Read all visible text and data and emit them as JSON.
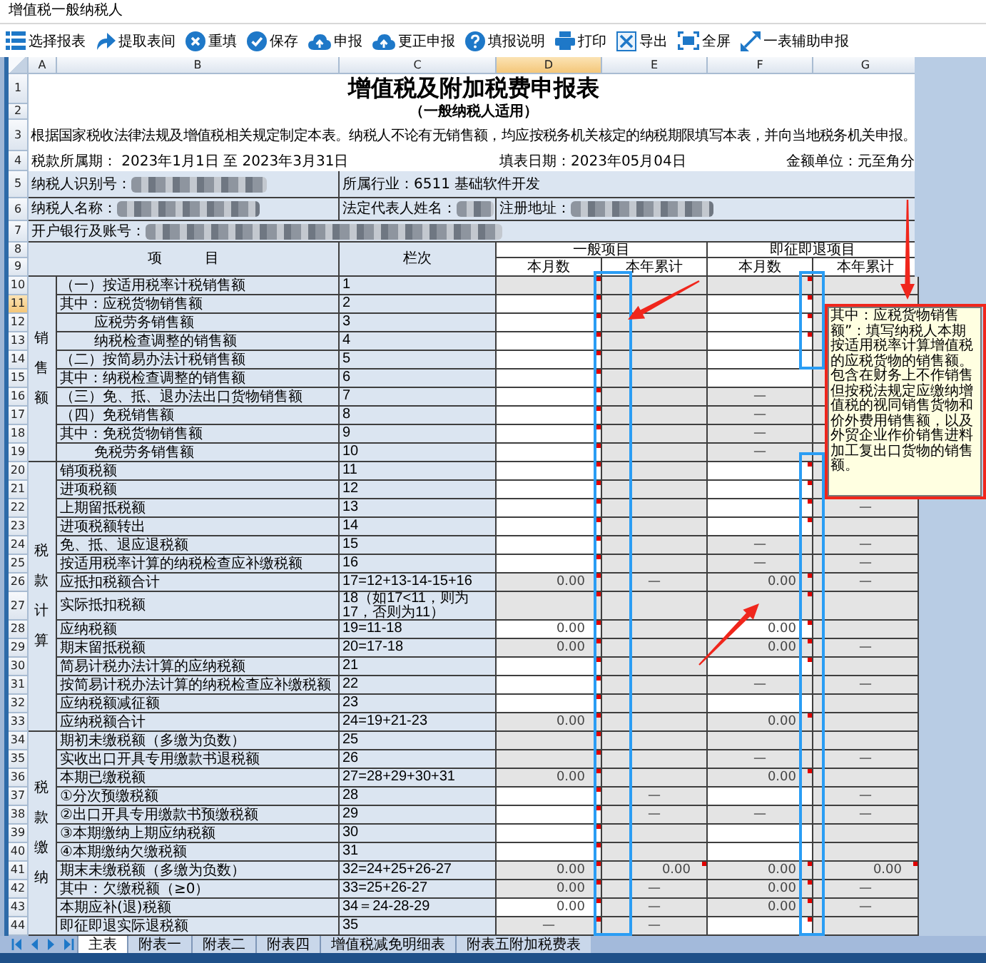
{
  "window": {
    "title": "增值税一般纳税人"
  },
  "toolbar": [
    {
      "label": "选择报表"
    },
    {
      "label": "提取表间"
    },
    {
      "label": "重填"
    },
    {
      "label": "保存"
    },
    {
      "label": "申报"
    },
    {
      "label": "更正申报"
    },
    {
      "label": "填报说明"
    },
    {
      "label": "打印"
    },
    {
      "label": "导出"
    },
    {
      "label": "全屏"
    },
    {
      "label": "一表辅助申报"
    }
  ],
  "sheet": {
    "columns": [
      {
        "label": "A",
        "selected": false
      },
      {
        "label": "B",
        "selected": false
      },
      {
        "label": "C",
        "selected": false
      },
      {
        "label": "D",
        "selected": true
      },
      {
        "label": "E",
        "selected": false
      },
      {
        "label": "F",
        "selected": false
      },
      {
        "label": "G",
        "selected": false
      }
    ],
    "row_numbers": [
      {
        "label": "1",
        "selected": false
      },
      {
        "label": "2",
        "selected": false
      },
      {
        "label": "3",
        "selected": false
      },
      {
        "label": "4",
        "selected": false
      },
      {
        "label": "5",
        "selected": false
      },
      {
        "label": "6",
        "selected": false
      },
      {
        "label": "7",
        "selected": false
      },
      {
        "label": "8",
        "selected": false
      },
      {
        "label": "9",
        "selected": false
      },
      {
        "label": "10",
        "selected": false
      },
      {
        "label": "11",
        "selected": true
      },
      {
        "label": "12",
        "selected": false
      },
      {
        "label": "13",
        "selected": false
      },
      {
        "label": "14",
        "selected": false
      },
      {
        "label": "15",
        "selected": false
      },
      {
        "label": "16",
        "selected": false
      },
      {
        "label": "17",
        "selected": false
      },
      {
        "label": "18",
        "selected": false
      },
      {
        "label": "19",
        "selected": false
      },
      {
        "label": "20",
        "selected": false
      },
      {
        "label": "21",
        "selected": false
      },
      {
        "label": "22",
        "selected": false
      },
      {
        "label": "23",
        "selected": false
      },
      {
        "label": "24",
        "selected": false
      },
      {
        "label": "25",
        "selected": false
      },
      {
        "label": "26",
        "selected": false
      },
      {
        "label": "27",
        "selected": false
      },
      {
        "label": "28",
        "selected": false
      },
      {
        "label": "29",
        "selected": false
      },
      {
        "label": "30",
        "selected": false
      },
      {
        "label": "31",
        "selected": false
      },
      {
        "label": "32",
        "selected": false
      },
      {
        "label": "33",
        "selected": false
      },
      {
        "label": "34",
        "selected": false
      },
      {
        "label": "35",
        "selected": false
      },
      {
        "label": "36",
        "selected": false
      },
      {
        "label": "37",
        "selected": false
      },
      {
        "label": "38",
        "selected": false
      },
      {
        "label": "39",
        "selected": false
      },
      {
        "label": "40",
        "selected": false
      },
      {
        "label": "41",
        "selected": false
      },
      {
        "label": "42",
        "selected": false
      },
      {
        "label": "43",
        "selected": false
      },
      {
        "label": "44",
        "selected": false
      }
    ],
    "title": "增值税及附加税费申报表",
    "subtitle": "（一般纳税人适用）",
    "notice": "根据国家税收法律法规及增值税相关规定制定本表。纳税人不论有无销售额，均应按税务机关核定的纳税期限填写本表，并向当地税务机关申报。",
    "period": "税款所属期：  2023年1月1日 至 2023年3月31日",
    "fill_date": "填表日期：2023年05月04日",
    "unit": "金额单位：元至角分",
    "info_fields": [
      {
        "label": "纳税人识别号：",
        "blurred": true
      },
      {
        "label": "所属行业：6511 基础软件开发",
        "blurred": false
      },
      {
        "label": "纳税人名称：",
        "blurred": true
      },
      {
        "label": "法定代表人姓名：",
        "blurred": true
      },
      {
        "label": "注册地址：",
        "blurred": true
      },
      {
        "label": "开户银行及账号：",
        "blurred": true
      }
    ],
    "headers": {
      "item": "项　　　目",
      "line_no": "栏次",
      "general": "一般项目",
      "immediate": "即征即退项目",
      "sub": [
        "本月数",
        "本年累计",
        "本月数",
        "本年累计"
      ]
    },
    "sections": [
      {
        "label": "销售额",
        "rows": [
          {
            "label": "（一）按适用税率计税销售额",
            "kind": "item",
            "line": "1",
            "cells": [
              {
                "editable": false,
                "note": true
              },
              {
                "editable": false,
                "note": false
              },
              {
                "editable": false,
                "note": true
              },
              {
                "editable": false,
                "note": false
              }
            ]
          },
          {
            "label": "其中：应税货物销售额",
            "kind": "item",
            "line": "2",
            "cells": [
              {
                "editable": true,
                "note": true
              },
              {
                "editable": false,
                "note": false
              },
              {
                "editable": true,
                "note": true
              },
              {
                "editable": false
              }
            ]
          },
          {
            "label": "应税劳务销售额",
            "kind": "sub",
            "line": "3",
            "cells": [
              {
                "editable": true,
                "note": true
              },
              {
                "editable": false,
                "note": false
              },
              {
                "editable": true,
                "note": true
              },
              {
                "editable": false
              }
            ]
          },
          {
            "label": "纳税检查调整的销售额",
            "kind": "sub",
            "line": "4",
            "cells": [
              {
                "editable": true,
                "note": true
              },
              {
                "editable": false,
                "note": false
              },
              {
                "editable": true,
                "note": true
              },
              {
                "editable": false
              }
            ]
          },
          {
            "label": "（二）按简易办法计税销售额",
            "kind": "item",
            "line": "5",
            "cells": [
              {
                "editable": true,
                "note": true
              },
              {
                "editable": false,
                "note": false
              },
              {
                "editable": true,
                "note": false
              },
              {
                "editable": false
              }
            ]
          },
          {
            "label": "其中：纳税检查调整的销售额",
            "kind": "item",
            "line": "6",
            "cells": [
              {
                "editable": true,
                "note": true
              },
              {
                "editable": false,
                "note": false
              },
              {
                "editable": true,
                "note": false
              },
              {
                "editable": false
              }
            ]
          },
          {
            "label": "（三）免、抵、退办法出口货物销售额",
            "kind": "item",
            "line": "7",
            "cells": [
              {
                "editable": true,
                "note": true
              },
              {
                "editable": false,
                "note": false
              },
              {
                "editable": false,
                "note": false,
                "value": "—",
                "kind": "na"
              },
              {
                "editable": false
              }
            ]
          },
          {
            "label": "（四）免税销售额",
            "kind": "item",
            "line": "8",
            "cells": [
              {
                "editable": true,
                "note": true
              },
              {
                "editable": false,
                "note": false
              },
              {
                "editable": false,
                "note": false,
                "value": "—",
                "kind": "na"
              },
              {
                "editable": false
              }
            ]
          },
          {
            "label": "其中：免税货物销售额",
            "kind": "item",
            "line": "9",
            "cells": [
              {
                "editable": true,
                "note": true
              },
              {
                "editable": false,
                "note": false
              },
              {
                "editable": false,
                "note": false,
                "value": "—",
                "kind": "na"
              },
              {
                "editable": false
              }
            ]
          },
          {
            "label": "免税劳务销售额",
            "kind": "sub",
            "line": "10",
            "cells": [
              {
                "editable": true,
                "note": true
              },
              {
                "editable": false,
                "note": false
              },
              {
                "editable": false,
                "note": false,
                "value": "—",
                "kind": "na"
              },
              {
                "editable": false
              }
            ]
          }
        ]
      },
      {
        "label": "税款计算",
        "rows": [
          {
            "label": "销项税额",
            "kind": "item",
            "line": "11",
            "cells": [
              {
                "editable": true,
                "note": true
              },
              {
                "editable": false,
                "note": false
              },
              {
                "editable": true,
                "note": true
              },
              {
                "editable": false
              }
            ]
          },
          {
            "label": "进项税额",
            "kind": "item",
            "line": "12",
            "cells": [
              {
                "editable": true,
                "note": true
              },
              {
                "editable": false,
                "note": false
              },
              {
                "editable": true,
                "note": true
              },
              {
                "editable": false
              }
            ]
          },
          {
            "label": "上期留抵税额",
            "kind": "item",
            "line": "13",
            "cells": [
              {
                "editable": true,
                "note": true
              },
              {
                "editable": false,
                "note": false
              },
              {
                "editable": true,
                "note": true
              },
              {
                "editable": false,
                "note": false,
                "value": "—",
                "kind": "na"
              }
            ]
          },
          {
            "label": "进项税额转出",
            "kind": "item",
            "line": "14",
            "cells": [
              {
                "editable": true,
                "note": true
              },
              {
                "editable": false,
                "note": false
              },
              {
                "editable": true,
                "note": true
              },
              {
                "editable": false,
                "note": false
              }
            ]
          },
          {
            "label": "免、抵、退应退税额",
            "kind": "item",
            "line": "15",
            "cells": [
              {
                "editable": true,
                "note": true
              },
              {
                "editable": false,
                "note": false
              },
              {
                "editable": false,
                "note": false,
                "value": "—",
                "kind": "na"
              },
              {
                "editable": false,
                "note": false,
                "value": "—",
                "kind": "na"
              }
            ]
          },
          {
            "label": "按适用税率计算的纳税检查应补缴税额",
            "kind": "item",
            "line": "16",
            "cells": [
              {
                "editable": true,
                "note": true
              },
              {
                "editable": false,
                "note": false
              },
              {
                "editable": false,
                "note": false,
                "value": "—",
                "kind": "na"
              },
              {
                "editable": false,
                "note": false,
                "value": "—",
                "kind": "na"
              }
            ]
          },
          {
            "label": "应抵扣税额合计",
            "kind": "item",
            "line": "17=12+13-14-15+16",
            "cells": [
              {
                "editable": false,
                "note": true,
                "value": "0.00",
                "kind": "amount"
              },
              {
                "editable": false,
                "note": false,
                "value": "—",
                "kind": "na"
              },
              {
                "editable": false,
                "note": true,
                "value": "0.00",
                "kind": "amount"
              },
              {
                "editable": false,
                "note": false,
                "value": "—",
                "kind": "na"
              }
            ]
          },
          {
            "label": "实际抵扣税额",
            "kind": "item",
            "line": "18（如17<11，则为17，否则为11）",
            "cells": [
              {
                "editable": false,
                "note": true
              },
              {
                "editable": false,
                "note": false
              },
              {
                "editable": false,
                "note": true
              },
              {
                "editable": false,
                "note": false
              }
            ]
          },
          {
            "label": "应纳税额",
            "kind": "item",
            "line": "19=11-18",
            "cells": [
              {
                "editable": true,
                "note": true,
                "value": "0.00",
                "kind": "amount"
              },
              {
                "editable": false,
                "note": false
              },
              {
                "editable": true,
                "note": true,
                "value": "0.00",
                "kind": "amount"
              },
              {
                "editable": false,
                "note": false
              }
            ]
          },
          {
            "label": "期末留抵税额",
            "kind": "item",
            "line": "20=17-18",
            "cells": [
              {
                "editable": false,
                "note": true,
                "value": "0.00",
                "kind": "amount"
              },
              {
                "editable": false,
                "note": false
              },
              {
                "editable": false,
                "note": true,
                "value": "0.00",
                "kind": "amount"
              },
              {
                "editable": false,
                "note": false,
                "value": "—",
                "kind": "na"
              }
            ]
          },
          {
            "label": "简易计税办法计算的应纳税额",
            "kind": "item",
            "line": "21",
            "cells": [
              {
                "editable": true,
                "note": true
              },
              {
                "editable": false,
                "note": false
              },
              {
                "editable": true,
                "note": true
              },
              {
                "editable": false,
                "note": false
              }
            ]
          },
          {
            "label": "按简易计税办法计算的纳税检查应补缴税额",
            "kind": "item",
            "line": "22",
            "cells": [
              {
                "editable": true,
                "note": true
              },
              {
                "editable": false,
                "note": false
              },
              {
                "editable": false,
                "note": false,
                "value": "—",
                "kind": "na"
              },
              {
                "editable": false,
                "note": false,
                "value": "—",
                "kind": "na"
              }
            ]
          },
          {
            "label": "应纳税额减征额",
            "kind": "item",
            "line": "23",
            "cells": [
              {
                "editable": true,
                "note": true
              },
              {
                "editable": false,
                "note": false
              },
              {
                "editable": true,
                "note": false
              },
              {
                "editable": false,
                "note": false
              }
            ]
          },
          {
            "label": "应纳税额合计",
            "kind": "item",
            "line": "24=19+21-23",
            "cells": [
              {
                "editable": false,
                "note": true,
                "value": "0.00",
                "kind": "amount"
              },
              {
                "editable": false,
                "note": false
              },
              {
                "editable": false,
                "note": true,
                "value": "0.00",
                "kind": "amount"
              },
              {
                "editable": false,
                "note": false
              }
            ]
          }
        ]
      },
      {
        "label": "税款缴纳",
        "rows": [
          {
            "label": "期初未缴税额（多缴为负数）",
            "kind": "item",
            "line": "25",
            "cells": [
              {
                "editable": false,
                "note": true
              },
              {
                "editable": false,
                "note": false
              },
              {
                "editable": false,
                "note": false
              },
              {
                "editable": false,
                "note": false
              }
            ]
          },
          {
            "label": "实收出口开具专用缴款书退税额",
            "kind": "item",
            "line": "26",
            "cells": [
              {
                "editable": false,
                "note": true
              },
              {
                "editable": false,
                "note": false
              },
              {
                "editable": false,
                "note": false,
                "value": "—",
                "kind": "na"
              },
              {
                "editable": false,
                "note": false,
                "value": "—",
                "kind": "na"
              }
            ]
          },
          {
            "label": "本期已缴税额",
            "kind": "item",
            "line": "27=28+29+30+31",
            "cells": [
              {
                "editable": false,
                "note": true,
                "value": "0.00",
                "kind": "amount"
              },
              {
                "editable": false,
                "note": false
              },
              {
                "editable": false,
                "note": true,
                "value": "0.00",
                "kind": "amount"
              },
              {
                "editable": false,
                "note": false
              }
            ]
          },
          {
            "label": "①分次预缴税额",
            "kind": "item",
            "line": "28",
            "cells": [
              {
                "editable": true,
                "note": true
              },
              {
                "editable": false,
                "note": false,
                "value": "—",
                "kind": "na"
              },
              {
                "editable": true,
                "note": false
              },
              {
                "editable": false,
                "note": false,
                "value": "—",
                "kind": "na"
              }
            ]
          },
          {
            "label": "②出口开具专用缴款书预缴税额",
            "kind": "item",
            "line": "29",
            "cells": [
              {
                "editable": true,
                "note": true
              },
              {
                "editable": false,
                "note": false,
                "value": "—",
                "kind": "na"
              },
              {
                "editable": false,
                "note": false,
                "value": "—",
                "kind": "na"
              },
              {
                "editable": false,
                "note": false,
                "value": "—",
                "kind": "na"
              }
            ]
          },
          {
            "label": "③本期缴纳上期应纳税额",
            "kind": "item",
            "line": "30",
            "cells": [
              {
                "editable": true,
                "note": true
              },
              {
                "editable": false,
                "note": false
              },
              {
                "editable": true,
                "note": false
              },
              {
                "editable": false,
                "note": false
              }
            ]
          },
          {
            "label": "④本期缴纳欠缴税额",
            "kind": "item",
            "line": "31",
            "cells": [
              {
                "editable": true,
                "note": true
              },
              {
                "editable": false,
                "note": false
              },
              {
                "editable": true,
                "note": false
              },
              {
                "editable": false,
                "note": false
              }
            ]
          },
          {
            "label": "期末未缴税额（多缴为负数）",
            "kind": "item",
            "line": "32=24+25+26-27",
            "cells": [
              {
                "editable": false,
                "note": true,
                "value": "0.00",
                "kind": "amount"
              },
              {
                "editable": false,
                "note": true,
                "value": "0.00",
                "kind": "amount"
              },
              {
                "editable": false,
                "note": true,
                "value": "0.00",
                "kind": "amount"
              },
              {
                "editable": false,
                "note": true,
                "value": "0.00",
                "kind": "amount"
              }
            ]
          },
          {
            "label": "其中：欠缴税额（≥0）",
            "kind": "item",
            "line": "33=25+26-27",
            "cells": [
              {
                "editable": false,
                "note": true,
                "value": "0.00",
                "kind": "amount"
              },
              {
                "editable": false,
                "note": false,
                "value": "—",
                "kind": "na"
              },
              {
                "editable": false,
                "note": true,
                "value": "0.00",
                "kind": "amount"
              },
              {
                "editable": false,
                "note": false,
                "value": "—",
                "kind": "na"
              }
            ]
          },
          {
            "label": "本期应补(退)税额",
            "kind": "item",
            "line": "34＝24-28-29",
            "cells": [
              {
                "editable": true,
                "note": true,
                "value": "0.00",
                "kind": "amount"
              },
              {
                "editable": false,
                "note": false,
                "value": "—",
                "kind": "na"
              },
              {
                "editable": false,
                "note": true,
                "value": "0.00",
                "kind": "amount"
              },
              {
                "editable": false,
                "note": false,
                "value": "—",
                "kind": "na"
              }
            ]
          },
          {
            "label": "即征即退实际退税额",
            "kind": "item",
            "line": "35",
            "cells": [
              {
                "editable": false,
                "note": true,
                "value": "—",
                "kind": "na"
              },
              {
                "editable": false,
                "note": false,
                "value": "—",
                "kind": "na"
              },
              {
                "editable": true,
                "note": true
              },
              {
                "editable": false,
                "note": false
              }
            ]
          }
        ]
      }
    ]
  },
  "tooltip": {
    "text": "其中：应税货物销售额”：填写纳税人本期按适用税率计算增值税的应税货物的销售额。包含在财务上不作销售但按税法规定应缴纳增值税的视同销售货物和价外费用销售额，以及外贸企业作价销售进料加工复出口货物的销售额。"
  },
  "annotations": [
    {
      "kind": "frame",
      "color": "#2a9df4"
    },
    {
      "kind": "frame",
      "color": "#2a9df4"
    },
    {
      "kind": "frame",
      "color": "#2a9df4"
    },
    {
      "kind": "frame",
      "color": "#f0261c"
    },
    {
      "kind": "arrow",
      "color": "#f0261c"
    },
    {
      "kind": "arrow",
      "color": "#f0261c"
    },
    {
      "kind": "arrow",
      "color": "#f0261c"
    }
  ],
  "sheet_tabs": [
    {
      "label": "主表",
      "selected": true
    },
    {
      "label": "附表一",
      "selected": false
    },
    {
      "label": "附表二",
      "selected": false
    },
    {
      "label": "附表四",
      "selected": false
    },
    {
      "label": "增值税减免明细表",
      "selected": false
    },
    {
      "label": "附表五附加税费表",
      "selected": false
    }
  ]
}
